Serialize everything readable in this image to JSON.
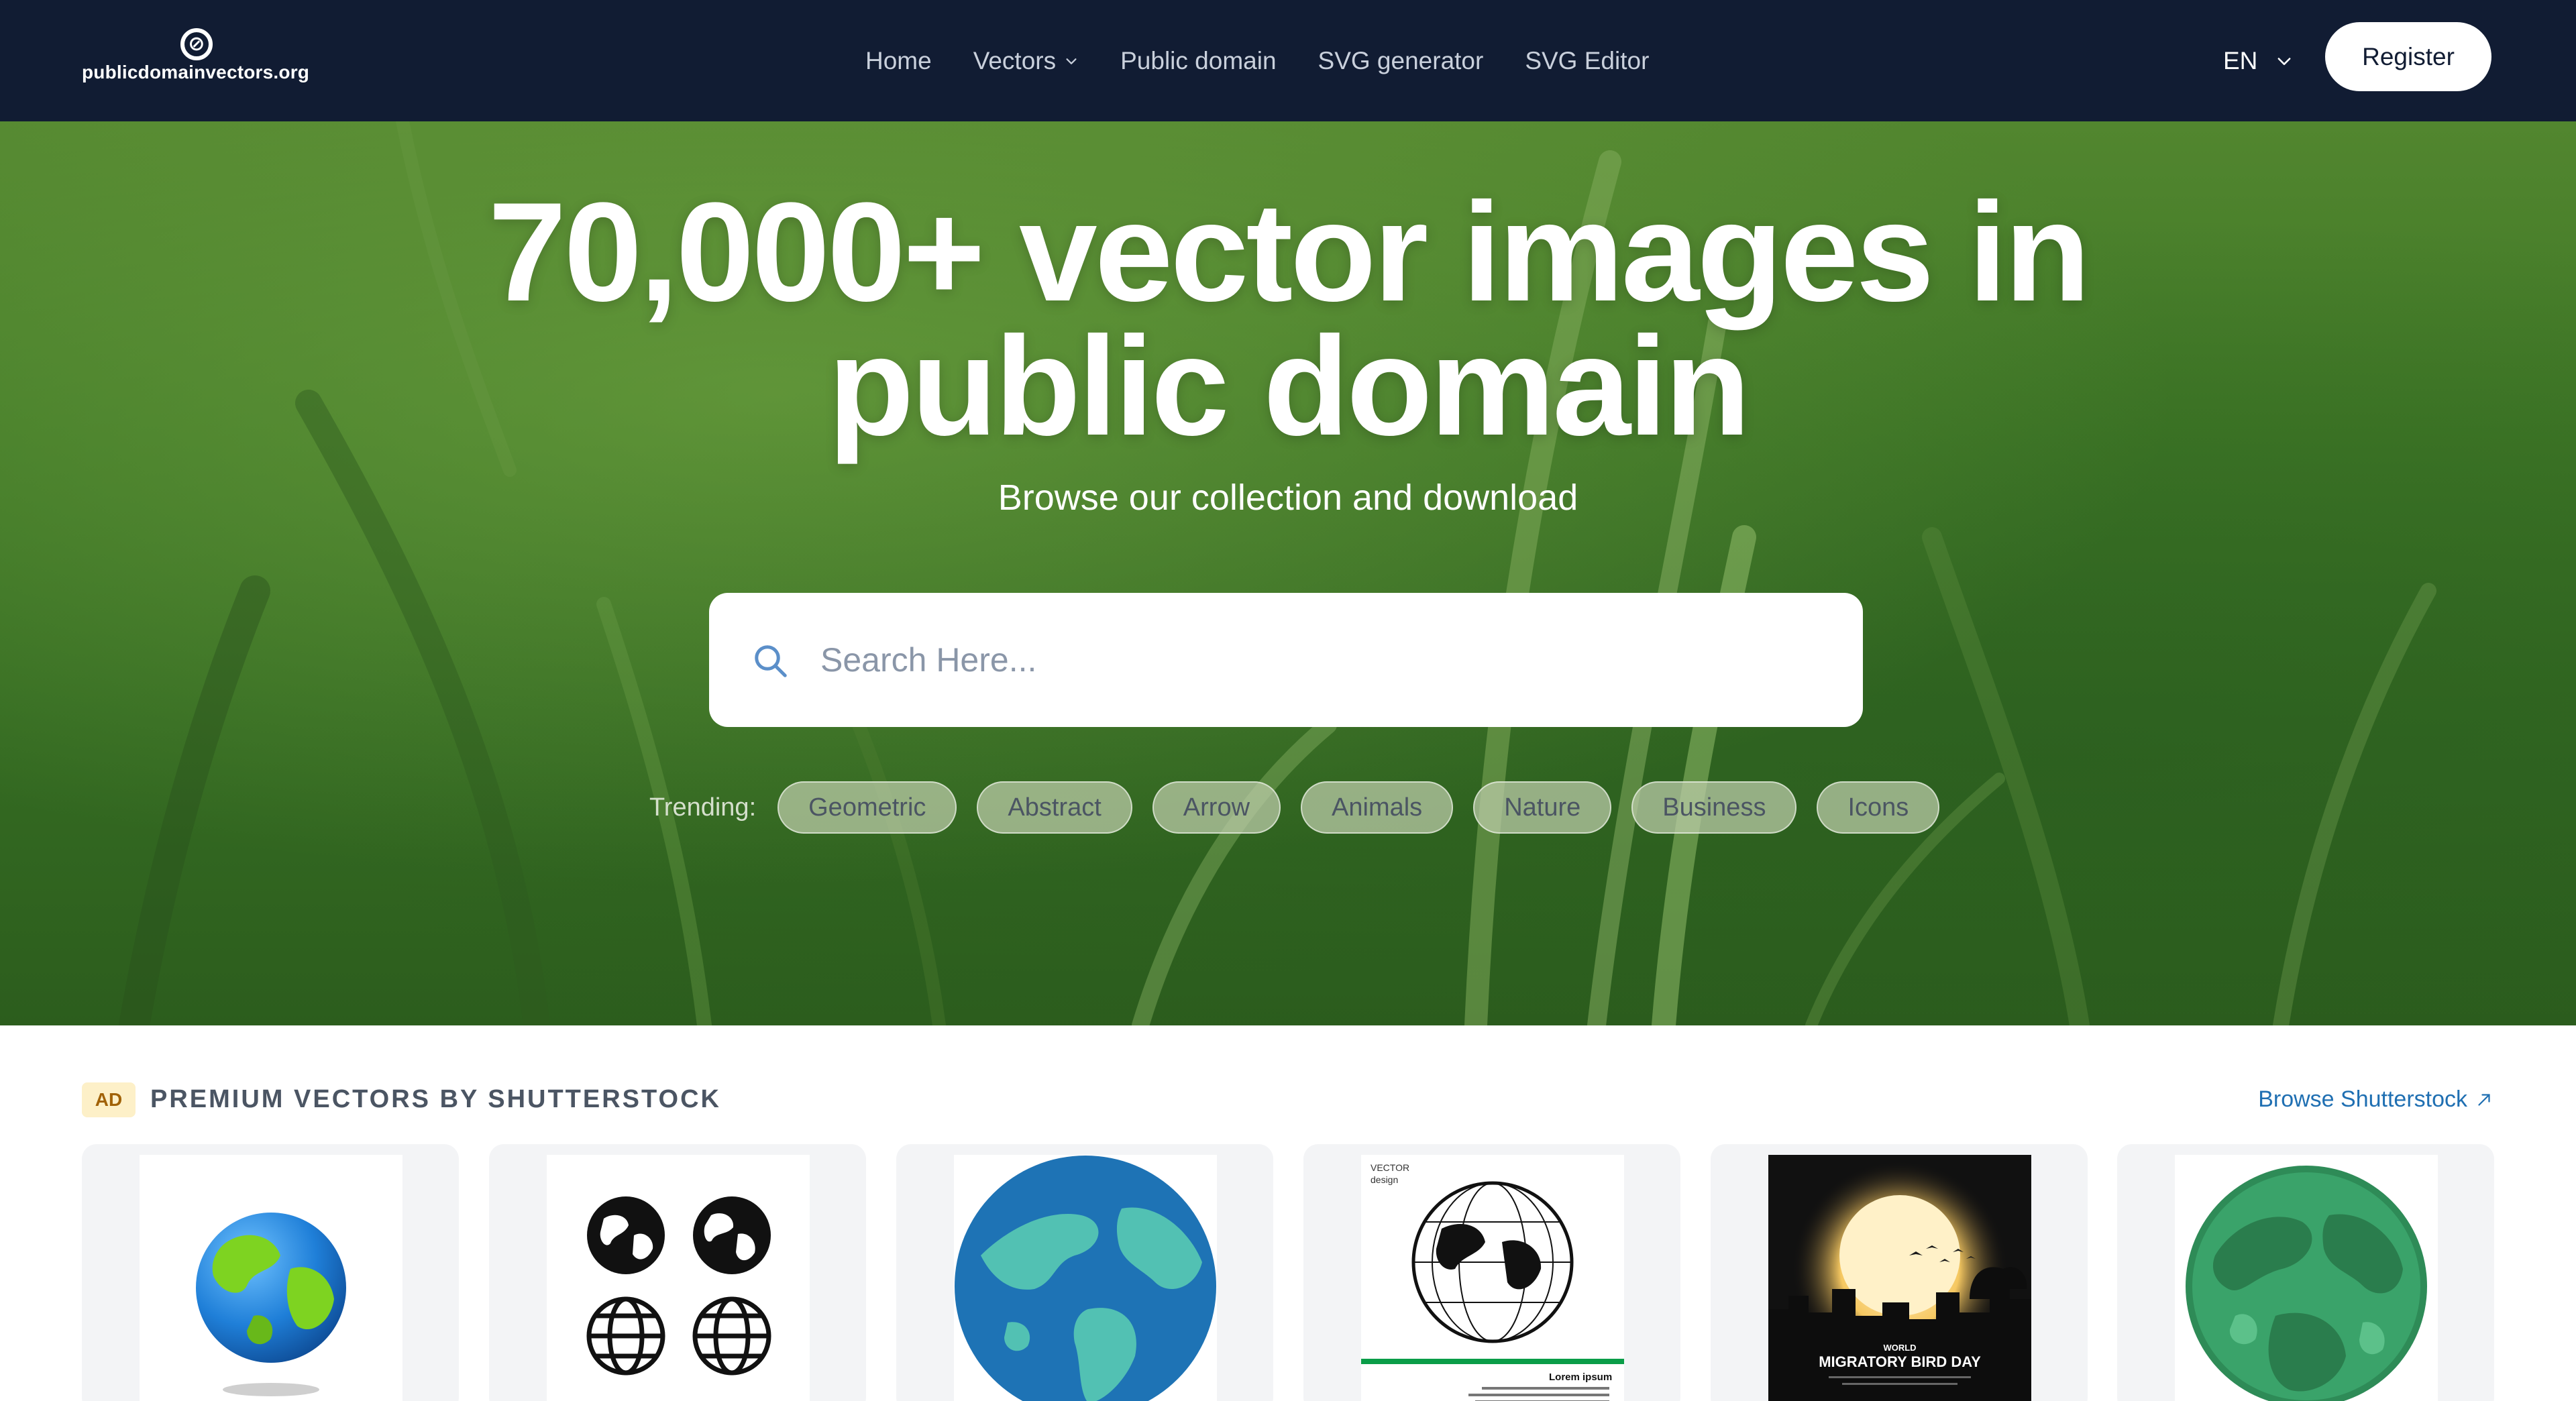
{
  "header": {
    "logo_text": "publicdomainvectors.org",
    "nav": [
      {
        "label": "Home"
      },
      {
        "label": "Vectors",
        "has_dropdown": true
      },
      {
        "label": "Public domain"
      },
      {
        "label": "SVG generator"
      },
      {
        "label": "SVG Editor"
      }
    ],
    "language": "EN",
    "register_label": "Register"
  },
  "hero": {
    "title_line1": "70,000+ vector images in",
    "title_line2": "public domain",
    "subtitle": "Browse our collection and download",
    "search_placeholder": "Search Here...",
    "trending_label": "Trending:",
    "trending": [
      "Geometric",
      "Abstract",
      "Arrow",
      "Animals",
      "Nature",
      "Business",
      "Icons"
    ]
  },
  "premium": {
    "ad_badge": "AD",
    "title": "PREMIUM VECTORS BY SHUTTERSTOCK",
    "browse_label": "Browse Shutterstock",
    "cards": [
      {
        "icon": "globe-3d-icon"
      },
      {
        "icon": "globe-icons-set-icon"
      },
      {
        "icon": "flat-earth-globe-icon"
      },
      {
        "icon": "vector-design-globe-icon",
        "caption_top": "VECTOR\ndesign",
        "caption_bottom": "Lorem ipsum"
      },
      {
        "icon": "migratory-bird-day-icon",
        "caption_small": "WORLD",
        "caption": "MIGRATORY BIRD DAY"
      },
      {
        "icon": "green-planet-icon"
      }
    ]
  },
  "colors": {
    "header_bg": "#111c33",
    "hero_green": "#3f7826",
    "link_blue": "#1f6fb2",
    "ad_badge_bg": "#fdf0c8"
  }
}
